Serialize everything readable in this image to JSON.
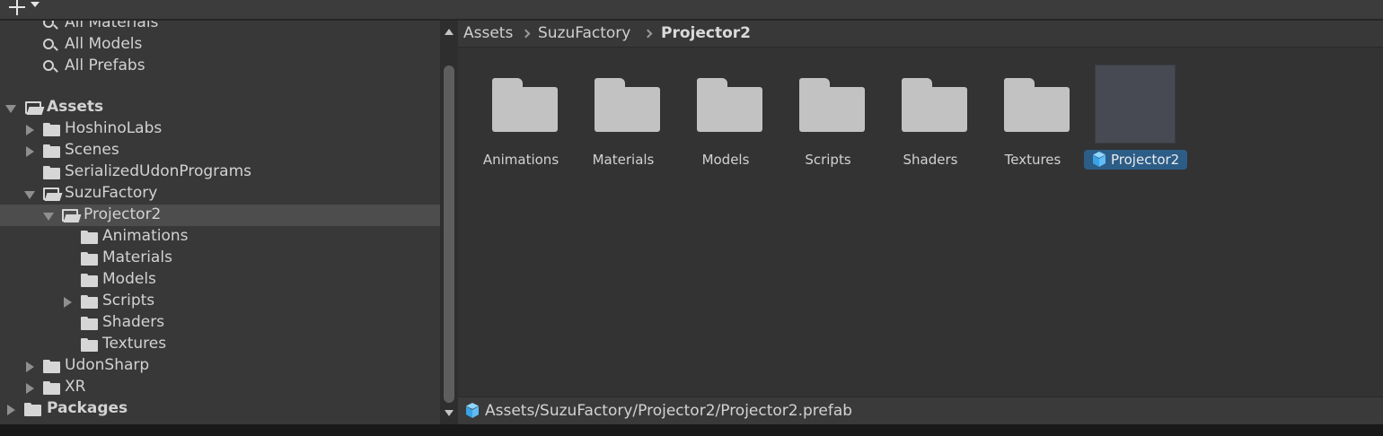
{
  "toolbar": {
    "add_button": "create-menu"
  },
  "tree": {
    "favorites": [
      {
        "label": "All Materials"
      },
      {
        "label": "All Models"
      },
      {
        "label": "All Prefabs"
      }
    ],
    "assets_root": "Assets",
    "assets_children": [
      {
        "label": "HoshinoLabs"
      },
      {
        "label": "Scenes"
      },
      {
        "label": "SerializedUdonPrograms"
      },
      {
        "label": "SuzuFactory"
      },
      {
        "label": "UdonSharp"
      },
      {
        "label": "XR"
      }
    ],
    "suzufactory_child": "Projector2",
    "projector2_children": [
      {
        "label": "Animations"
      },
      {
        "label": "Materials"
      },
      {
        "label": "Models"
      },
      {
        "label": "Scripts"
      },
      {
        "label": "Shaders"
      },
      {
        "label": "Textures"
      }
    ],
    "packages_root": "Packages"
  },
  "breadcrumb": {
    "items": [
      "Assets",
      "SuzuFactory",
      "Projector2"
    ]
  },
  "grid": {
    "folders": [
      "Animations",
      "Materials",
      "Models",
      "Scripts",
      "Shaders",
      "Textures"
    ],
    "prefab": "Projector2"
  },
  "status": {
    "path": "Assets/SuzuFactory/Projector2/Projector2.prefab"
  },
  "colors": {
    "selection": "#2c5d87",
    "folder": "#c2c2c2",
    "prefab_icon": "#3aa2e6"
  }
}
